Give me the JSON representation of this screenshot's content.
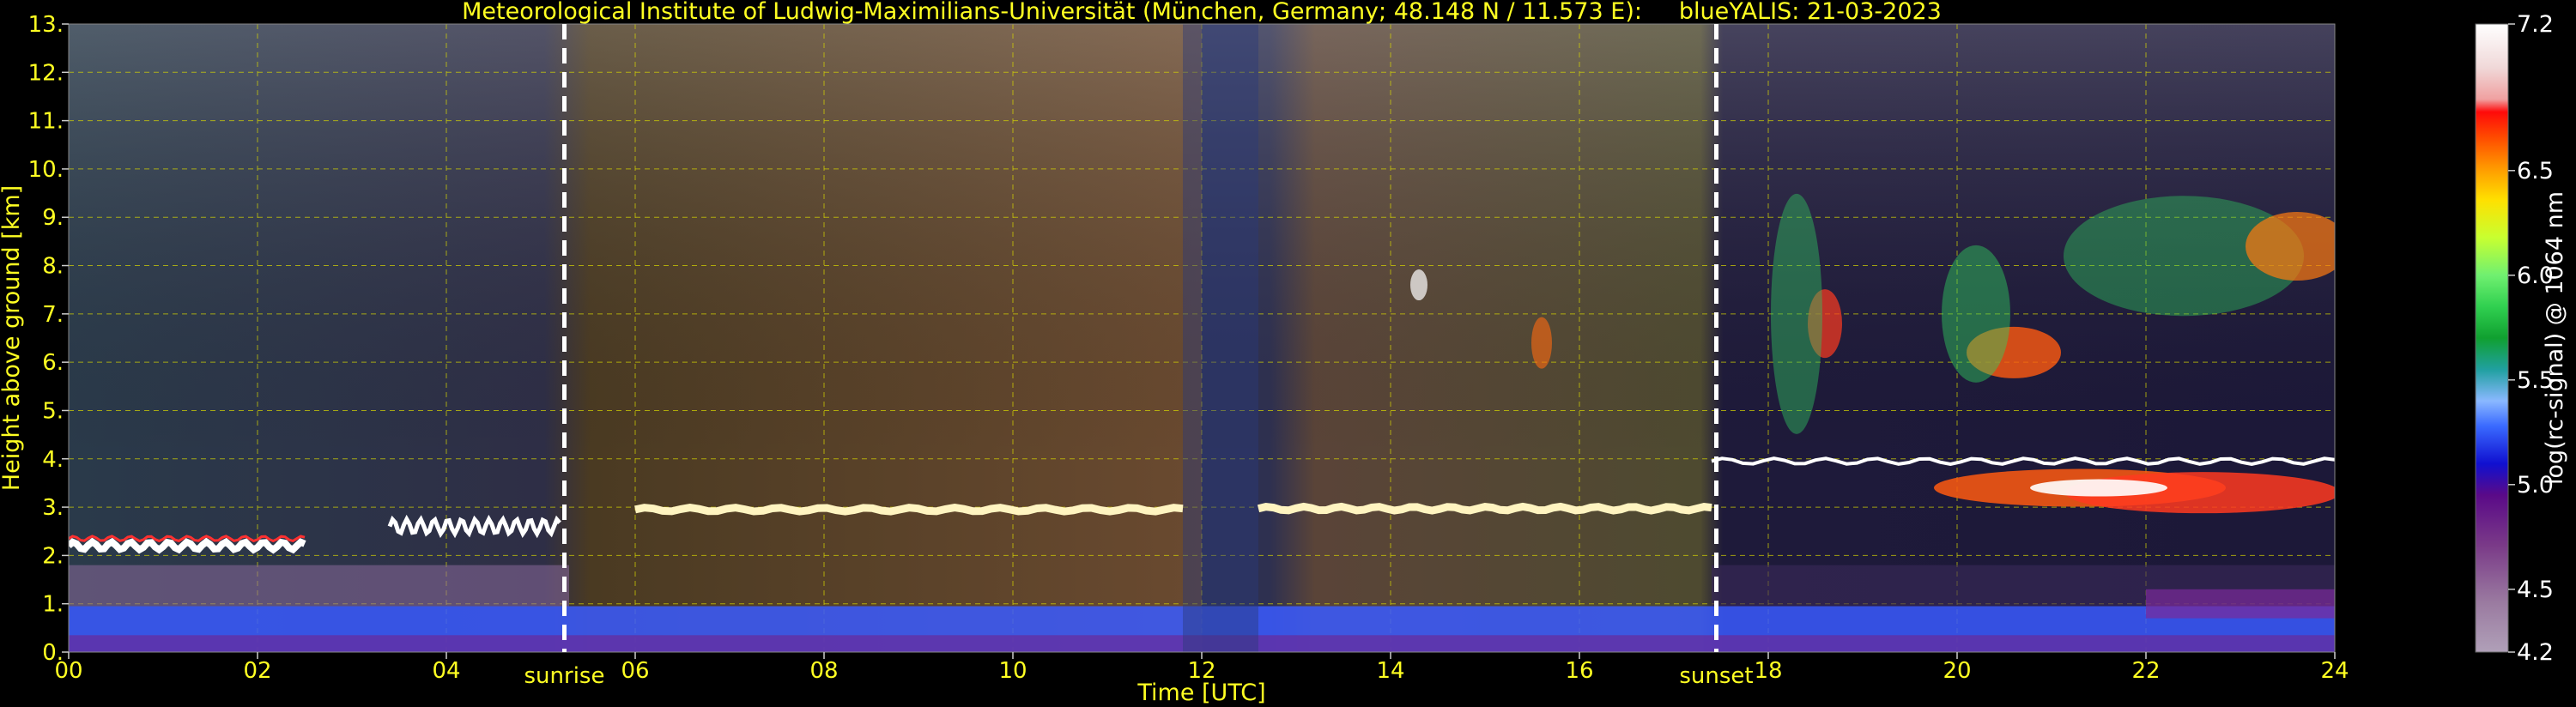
{
  "chart_data": {
    "type": "heatmap",
    "title": "Meteorological Institute of Ludwig-Maximilians-Universität (München, Germany; 48.148 N / 11.573 E):     blueYALIS: 21-03-2023",
    "xlabel": "Time [UTC]",
    "ylabel": "Height above ground [km]",
    "xlim": [
      0,
      24
    ],
    "ylim": [
      0,
      13
    ],
    "x_ticks": [
      "00",
      "02",
      "04",
      "06",
      "08",
      "10",
      "12",
      "14",
      "16",
      "18",
      "20",
      "22",
      "24"
    ],
    "y_ticks": [
      "0.",
      "1.",
      "2.",
      "3.",
      "4.",
      "5.",
      "6.",
      "7.",
      "8.",
      "9.",
      "10.",
      "11.",
      "12.",
      "13."
    ],
    "grid": true,
    "annotations": [
      {
        "label": "sunrise",
        "x": 5.25
      },
      {
        "label": "sunset",
        "x": 17.45
      }
    ],
    "colorbar": {
      "label": "log(rc-signal) @ 1064 nm",
      "range": [
        4.2,
        7.2
      ],
      "ticks": [
        "7.2",
        "6.5",
        "6.0",
        "5.5",
        "5.0",
        "4.5",
        "4.2"
      ]
    },
    "colors": {
      "text": "#ffff22",
      "grid": "#d8d800",
      "marker": "#ffffff",
      "background": "#000000"
    }
  }
}
